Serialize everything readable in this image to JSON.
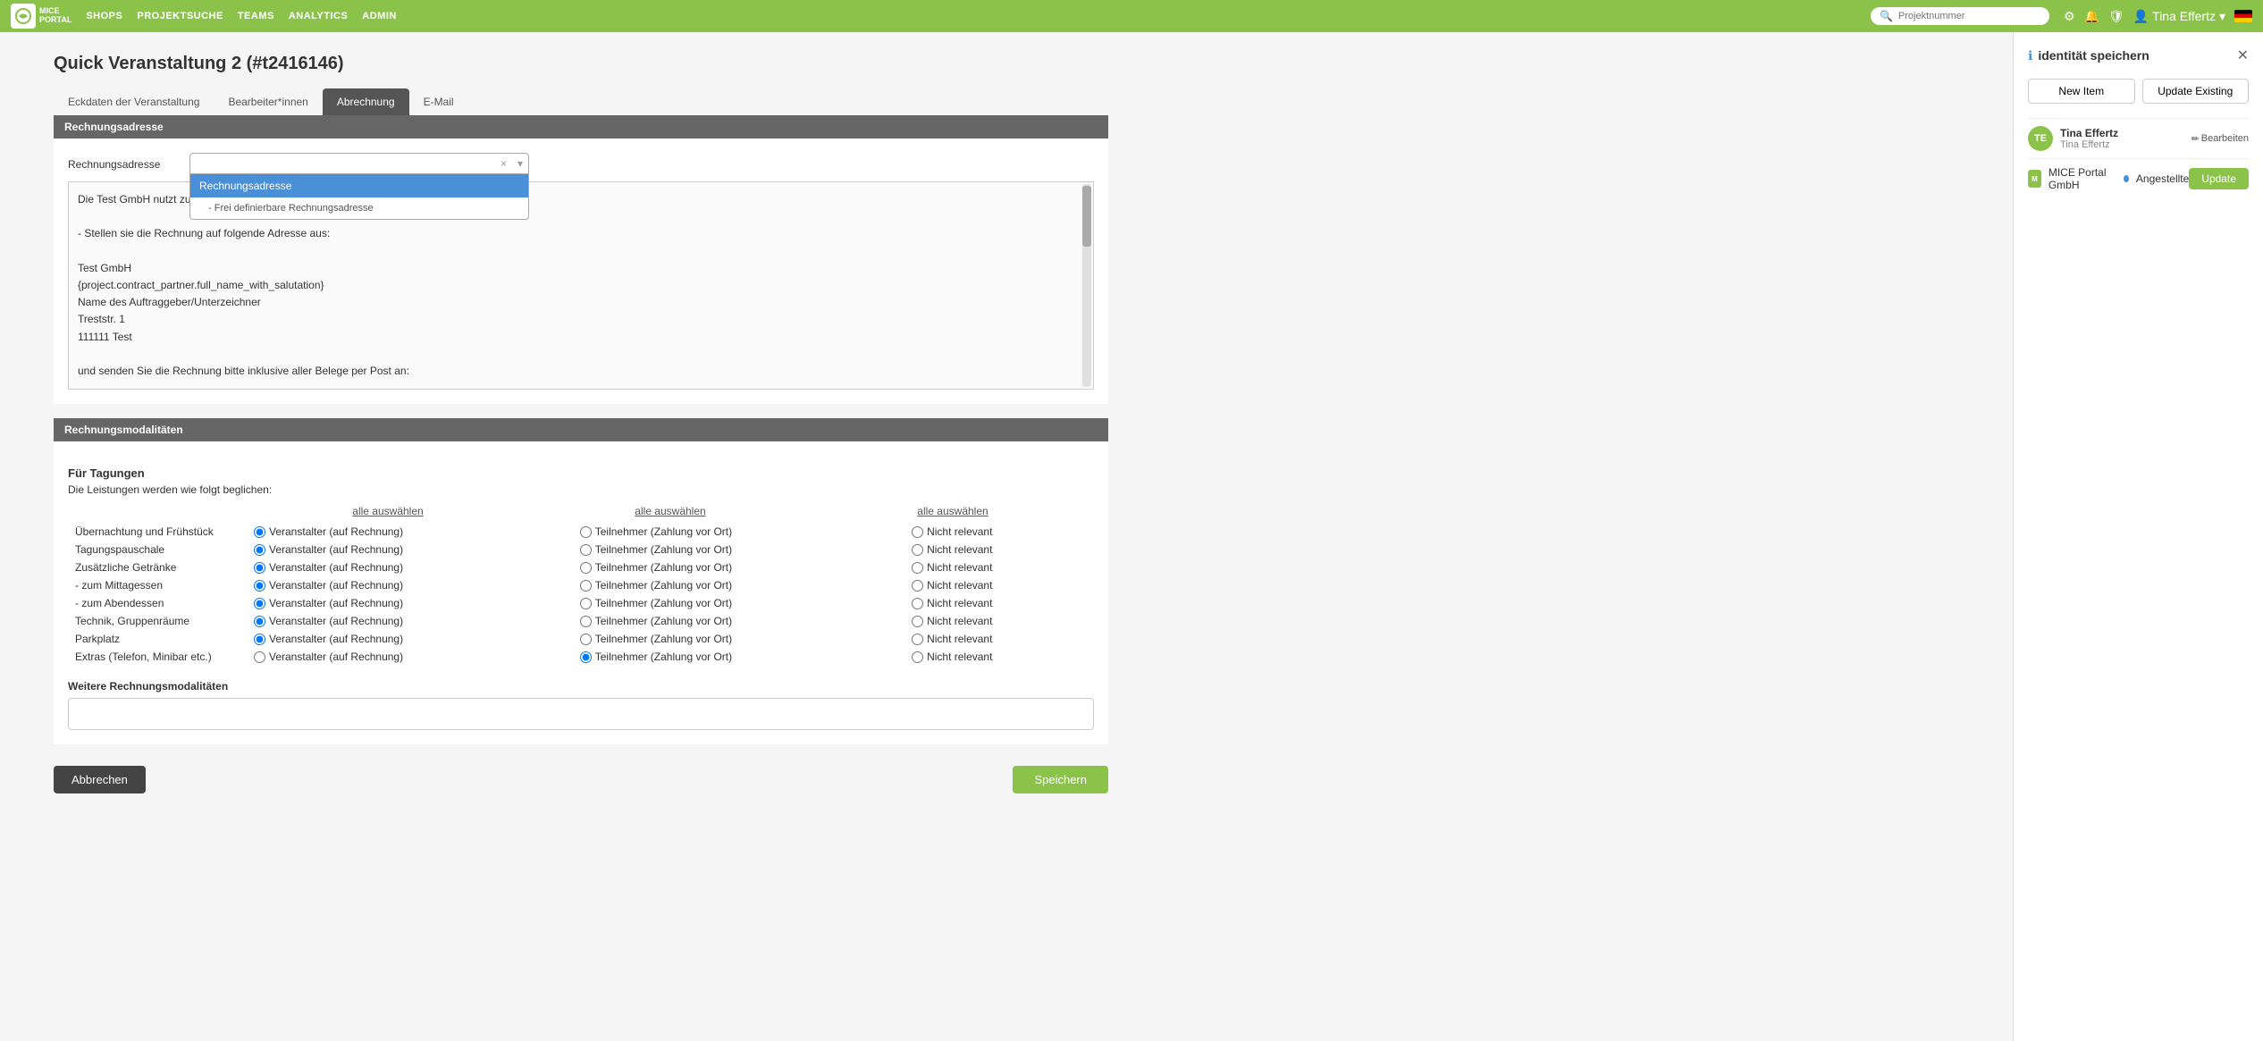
{
  "app": {
    "logo_line1": "MICE",
    "logo_line2": "PORTAL"
  },
  "topnav": {
    "menu_items": [
      "SHOPS",
      "PROJEKTSUCHE",
      "TEAMS",
      "ANALYTICS",
      "ADMIN"
    ],
    "search_placeholder": "Projektnummer",
    "user_name": "Tina Effertz"
  },
  "page": {
    "title": "Quick Veranstaltung 2 (#t2416146)"
  },
  "tabs": [
    {
      "label": "Eckdaten der Veranstaltung",
      "active": false
    },
    {
      "label": "Bearbeiter*innen",
      "active": false
    },
    {
      "label": "Abrechnung",
      "active": true
    },
    {
      "label": "E-Mail",
      "active": false
    }
  ],
  "sections": {
    "billing_address": {
      "header": "Rechnungsadresse",
      "label": "Rechnungsadresse",
      "select_value": "Rechnungsadresse",
      "search_value": "",
      "dropdown_options": [
        {
          "label": "Rechnungsadresse",
          "selected": true
        },
        {
          "label": "- Frei definierbare Rechnungsadresse",
          "selected": false
        }
      ],
      "text_lines": [
        "Die Test GmbH nutzt zur Abrechnung die MICE Portal GmbH. Dies be",
        "",
        "- Stellen sie die Rechnung auf folgende Adresse aus:",
        "",
        "Test GmbH",
        "{project.contract_partner.full_name_with_salutation}",
        "Name des Auftraggeber/Unterzeichner",
        "Treststr. 1",
        "111111 Test",
        "",
        "und senden Sie die Rechnung bitte inklusive aller Belege per Post an:"
      ]
    },
    "modalities": {
      "header": "Rechnungsmodalitäten",
      "tagungen_title": "Für Tagungen",
      "tagungen_desc": "Die Leistungen werden wie folgt beglichen:",
      "select_all_labels": [
        "alle auswählen",
        "alle auswählen",
        "alle auswählen"
      ],
      "rows": [
        {
          "label": "Übernachtung und Frühstück",
          "col1": {
            "label": "Veranstalter (auf Rechnung)",
            "checked": true
          },
          "col2": {
            "label": "Teilnehmer (Zahlung vor Ort)",
            "checked": false
          },
          "col3": {
            "label": "Nicht relevant",
            "checked": false
          }
        },
        {
          "label": "Tagungspauschale",
          "col1": {
            "label": "Veranstalter (auf Rechnung)",
            "checked": true
          },
          "col2": {
            "label": "Teilnehmer (Zahlung vor Ort)",
            "checked": false
          },
          "col3": {
            "label": "Nicht relevant",
            "checked": false
          }
        },
        {
          "label": "Zusätzliche Getränke",
          "col1": {
            "label": "Veranstalter (auf Rechnung)",
            "checked": true
          },
          "col2": {
            "label": "Teilnehmer (Zahlung vor Ort)",
            "checked": false
          },
          "col3": {
            "label": "Nicht relevant",
            "checked": false
          }
        },
        {
          "label": "- zum Mittagessen",
          "col1": {
            "label": "Veranstalter (auf Rechnung)",
            "checked": true
          },
          "col2": {
            "label": "Teilnehmer (Zahlung vor Ort)",
            "checked": false
          },
          "col3": {
            "label": "Nicht relevant",
            "checked": false
          }
        },
        {
          "label": "- zum Abendessen",
          "col1": {
            "label": "Veranstalter (auf Rechnung)",
            "checked": true
          },
          "col2": {
            "label": "Teilnehmer (Zahlung vor Ort)",
            "checked": false
          },
          "col3": {
            "label": "Nicht relevant",
            "checked": false
          }
        },
        {
          "label": "Technik, Gruppenräume",
          "col1": {
            "label": "Veranstalter (auf Rechnung)",
            "checked": true
          },
          "col2": {
            "label": "Teilnehmer (Zahlung vor Ort)",
            "checked": false
          },
          "col3": {
            "label": "Nicht relevant",
            "checked": false
          }
        },
        {
          "label": "Parkplatz",
          "col1": {
            "label": "Veranstalter (auf Rechnung)",
            "checked": true
          },
          "col2": {
            "label": "Teilnehmer (Zahlung vor Ort)",
            "checked": false
          },
          "col3": {
            "label": "Nicht relevant",
            "checked": false
          }
        },
        {
          "label": "Extras (Telefon, Minibar etc.)",
          "col1": {
            "label": "Veranstalter (auf Rechnung)",
            "checked": false
          },
          "col2": {
            "label": "Teilnehmer (Zahlung vor Ort)",
            "checked": true
          },
          "col3": {
            "label": "Nicht relevant",
            "checked": false
          }
        }
      ],
      "weitere_title": "Weitere Rechnungsmodalitäten",
      "weitere_placeholder": ""
    }
  },
  "buttons": {
    "cancel": "Abbrechen",
    "save": "Speichern"
  },
  "right_panel": {
    "title": "identität speichern",
    "new_item_label": "New Item",
    "update_existing_label": "Update Existing",
    "identity": {
      "name": "Tina Effertz",
      "sub": "Tina Effertz",
      "edit_label": "Bearbeiten"
    },
    "org": {
      "name": "MICE Portal GmbH",
      "badge1": "Angestellte",
      "update_btn": "Update"
    }
  }
}
